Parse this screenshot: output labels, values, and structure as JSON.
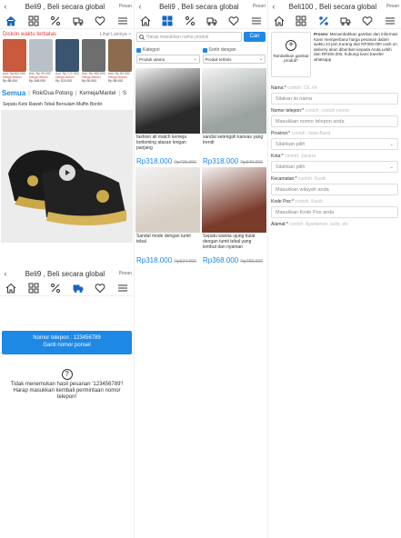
{
  "common": {
    "title": "Beli9 , Beli secara global",
    "extra": "Pesan"
  },
  "panel1": {
    "promo_title": "Diskon waktu terbatas",
    "promo_more": "Lihat Lainnya >",
    "promo_items": [
      {
        "sold": "Asli: Rp369.000",
        "label": "Harga diskon",
        "price": "Rp 88.000",
        "color": "#c95a3e"
      },
      {
        "sold": "Asli: Rp 99.000",
        "label": "Harga diskon",
        "price": "Rp 168.000",
        "color": "#b9c0c8"
      },
      {
        "sold": "Asli: Rp 172.000",
        "label": "Harga diskon",
        "price": "Rp 103.000",
        "color": "#3b5570"
      },
      {
        "sold": "Asli: Rp 350.000",
        "label": "Harga diskon",
        "price": "Rp 50.000",
        "color": "#6e6e6e"
      },
      {
        "sold": "Asli: Rp 89.000",
        "label": "Harga diskon",
        "price": "Rp 58.000",
        "color": "#8c6b4f"
      }
    ],
    "tabs": [
      "Semua",
      "Rok/Dua Potong",
      "Kemeja/Mantel",
      "S"
    ],
    "product_title": "Sepatu Kets Rawsh Tebal Bersulam Muffin Bordir",
    "phone_line1": "Nomor telepon : 123456789",
    "phone_line2": "Ganti nomor ponsel",
    "no_result": "Tidak menemukan hasil pesanan '123456789'! Harap masukkan kembali permintaan nomor telepon!",
    "extra2": "Pesan",
    "title2": "Beli9 , Beli secara global"
  },
  "panel2": {
    "search_placeholder": "Harap masukkan nama produk",
    "search_button": "Cari",
    "category_label": "Kategori",
    "category_value": "Produk utama",
    "sort_label": "Sortir dengan",
    "sort_value": "Produk terlaris",
    "products": [
      {
        "name": "fashion all match kemeja bottoming atasan lengan panjang",
        "price": "Rp318.000",
        "old": "Rp726.000",
        "color": "#2b2b2b"
      },
      {
        "name": "sandal setengah kanvas yang trendi",
        "price": "Rp318.000",
        "old": "Rp940.000",
        "color": "#9aa3a0"
      },
      {
        "name": "Sandal mode dengan tumit tebal",
        "price": "Rp318.000",
        "old": "Rp824.000",
        "color": "#d8cfc4"
      },
      {
        "name": "Sepatu wanita ujung bulat dengan tumit tebal yang lembut dan nyaman",
        "price": "Rp368.000",
        "old": "Rp783.000",
        "color": "#7a3b2a"
      }
    ]
  },
  "panel3": {
    "title": "Beli100 , Beli secara global",
    "extra": "Pesan",
    "upload_label": "Tambahkan gambar produk*",
    "process_title": "Proses:",
    "process_text": "Menambahkan gambar dan informasi Kami memperbarui harga pesanan dalam waktu 24 jam,Kurang dari RP300.000 cash on delivery akan diberikan kepada Anda.Lebih dari RP300.000, hubungi kami transfer whatsapp",
    "fields": [
      {
        "label": "Nama:*",
        "hint": "contoh: CE XA",
        "placeholder": "Silakan isi nama",
        "select": false
      },
      {
        "label": "Nomor telepon:*",
        "hint": "contoh: contoh-nomor",
        "placeholder": "Masukkan nomor telepon anda",
        "select": false
      },
      {
        "label": "Provinsi:*",
        "hint": "contoh: Jawa Barat",
        "placeholder": "Silahkan pilih",
        "select": true
      },
      {
        "label": "Kota:*",
        "hint": "contoh: Jakarta",
        "placeholder": "Silahkan pilih",
        "select": true
      },
      {
        "label": "Kecamatan:*",
        "hint": "contoh: Kasih",
        "placeholder": "Masukkan wilayah anda",
        "select": false
      },
      {
        "label": "Kode Pos:*",
        "hint": "contoh: Kasih",
        "placeholder": "Masukkan Kode Pos anda",
        "select": false
      },
      {
        "label": "Alamat:*",
        "hint": "contoh: Apartemen, suite, etc",
        "placeholder": "",
        "select": false
      }
    ]
  }
}
